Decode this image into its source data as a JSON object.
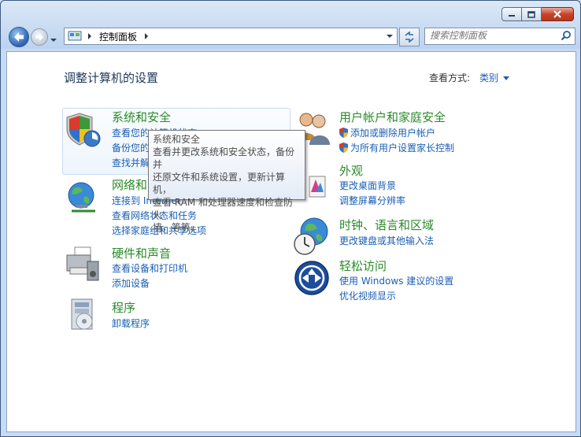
{
  "window": {
    "caption_buttons": [
      "minimize",
      "maximize",
      "close"
    ]
  },
  "navigation": {
    "address_path": "控制面板",
    "search_placeholder": "搜索控制面板"
  },
  "header": {
    "title": "调整计算机的设置",
    "view_by_label": "查看方式:",
    "view_by_value": "类别"
  },
  "categories": {
    "system": {
      "title": "系统和安全",
      "links": [
        "查看您的计算机状态",
        "备份您的计算机",
        "查找并解决问题"
      ]
    },
    "network": {
      "title": "网络和 Internet",
      "links": [
        "连接到 Internet",
        "查看网络状态和任务",
        "选择家庭组和共享选项"
      ]
    },
    "hardware": {
      "title": "硬件和声音",
      "links": [
        "查看设备和打印机",
        "添加设备"
      ]
    },
    "programs": {
      "title": "程序",
      "links": [
        "卸载程序"
      ]
    },
    "users": {
      "title": "用户帐户和家庭安全",
      "links": [
        "添加或删除用户帐户",
        "为所有用户设置家长控制"
      ]
    },
    "appearance": {
      "title": "外观",
      "links": [
        "更改桌面背景",
        "调整屏幕分辨率"
      ]
    },
    "clock": {
      "title": "时钟、语言和区域",
      "links": [
        "更改键盘或其他输入法"
      ]
    },
    "ease": {
      "title": "轻松访问",
      "links": [
        "使用 Windows 建议的设置",
        "优化视频显示"
      ]
    }
  },
  "tooltip": {
    "title": "系统和安全",
    "lines": [
      "查看并更改系统和安全状态，备份并",
      "还原文件和系统设置，更新计算机，",
      "查看 RAM 和处理器速度和检查防火",
      "墙，等等。"
    ]
  }
}
